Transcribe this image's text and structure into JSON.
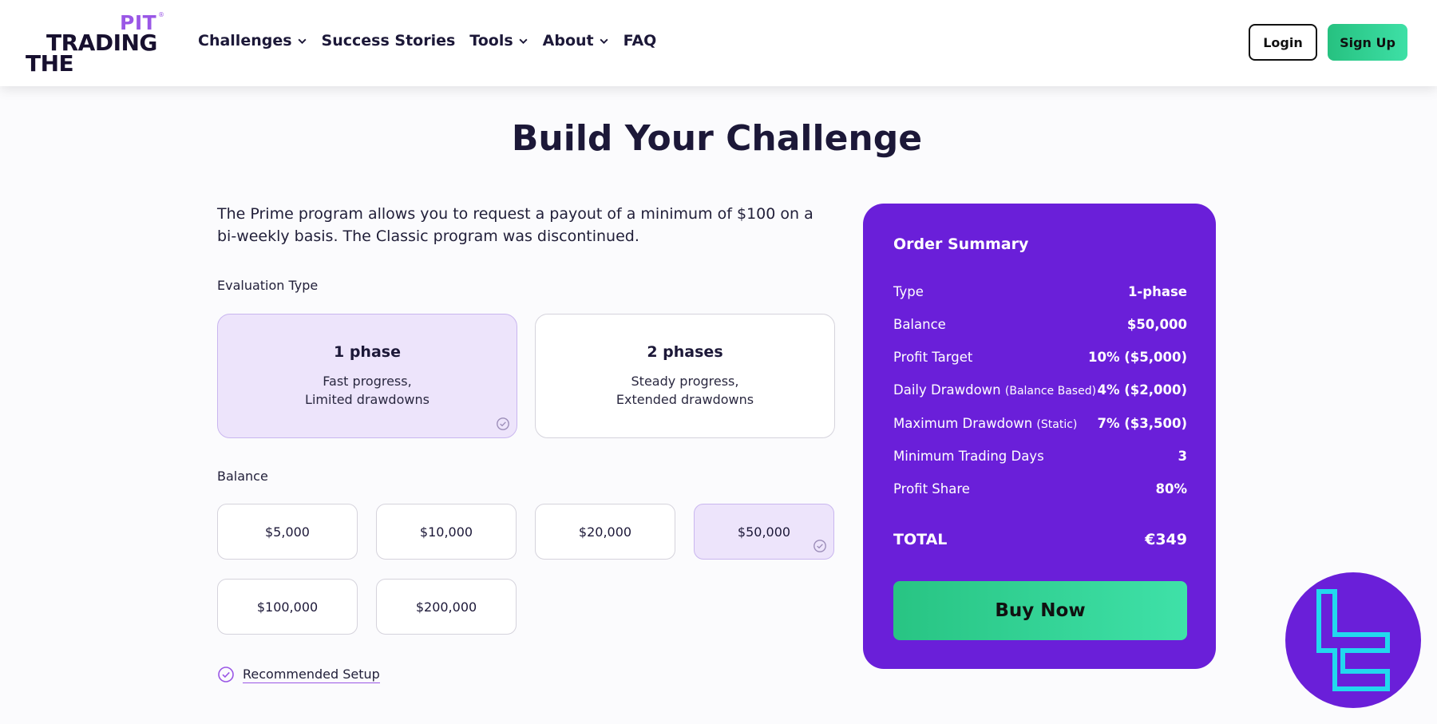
{
  "brand": {
    "top": "PIT",
    "reg": "®",
    "middle": "TRADING",
    "bottom": "THE"
  },
  "nav": {
    "items": [
      {
        "label": "Challenges",
        "dropdown": true
      },
      {
        "label": "Success Stories",
        "dropdown": false
      },
      {
        "label": "Tools",
        "dropdown": true
      },
      {
        "label": "About",
        "dropdown": true
      },
      {
        "label": "FAQ",
        "dropdown": false
      }
    ],
    "login_label": "Login",
    "signup_label": "Sign Up"
  },
  "page": {
    "title": "Build Your Challenge",
    "intro": "The Prime program allows you to request a payout of a minimum of $100 on a bi-weekly basis. The Classic program was discontinued."
  },
  "evaluation": {
    "label": "Evaluation Type",
    "options": [
      {
        "title": "1 phase",
        "line1": "Fast progress,",
        "line2": "Limited drawdowns",
        "selected": true
      },
      {
        "title": "2 phases",
        "line1": "Steady progress,",
        "line2": "Extended drawdowns",
        "selected": false
      }
    ]
  },
  "balance": {
    "label": "Balance",
    "options": [
      {
        "label": "$5,000",
        "selected": false
      },
      {
        "label": "$10,000",
        "selected": false
      },
      {
        "label": "$20,000",
        "selected": false
      },
      {
        "label": "$50,000",
        "selected": true
      },
      {
        "label": "$100,000",
        "selected": false
      },
      {
        "label": "$200,000",
        "selected": false
      }
    ]
  },
  "recommended_label": "Recommended Setup",
  "summary": {
    "title": "Order Summary",
    "rows": [
      {
        "key": "Type",
        "note": "",
        "value": "1-phase"
      },
      {
        "key": "Balance",
        "note": "",
        "value": "$50,000"
      },
      {
        "key": "Profit Target",
        "note": "",
        "value": "10% ($5,000)"
      },
      {
        "key": "Daily Drawdown",
        "note": "(Balance Based)",
        "value": "4% ($2,000)"
      },
      {
        "key": "Maximum Drawdown",
        "note": "(Static)",
        "value": "7% ($3,500)"
      },
      {
        "key": "Minimum Trading Days",
        "note": "",
        "value": "3"
      },
      {
        "key": "Profit Share",
        "note": "",
        "value": "80%"
      }
    ],
    "total_label": "TOTAL",
    "total_value": "€349",
    "buy_label": "Buy Now"
  },
  "colors": {
    "accent_purple": "#6a1fd9",
    "brand_purple": "#9a57e6",
    "cta_green": "#2fcf8f",
    "selected_bg": "#ede4fb",
    "watermark_cyan": "#22d8ee"
  },
  "icons": [
    "chevron-down-icon",
    "check-circle-icon",
    "watermark-logo-icon"
  ]
}
